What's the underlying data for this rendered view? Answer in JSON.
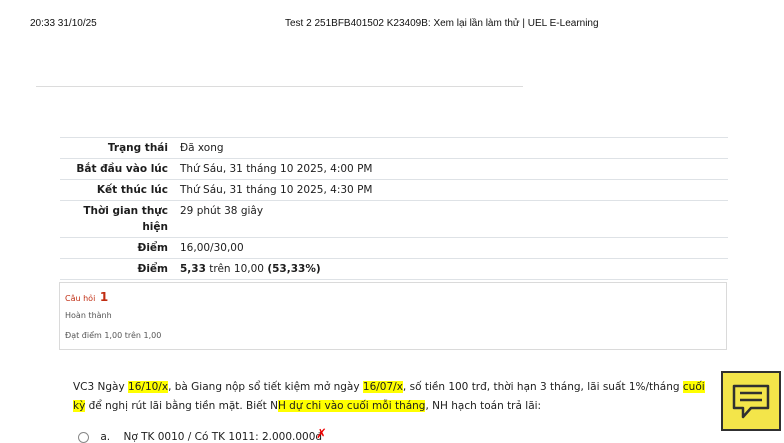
{
  "print_header": {
    "timestamp": "20:33 31/10/25",
    "title": "Test 2 251BFB401502 K23409B: Xem lại lần làm thử | UEL E-Learning"
  },
  "summary": {
    "rows": [
      {
        "label": "Trạng thái",
        "value": "Đã xong"
      },
      {
        "label": "Bắt đầu vào lúc",
        "value": "Thứ Sáu, 31 tháng 10 2025, 4:00 PM"
      },
      {
        "label": "Kết thúc lúc",
        "value": "Thứ Sáu, 31 tháng 10 2025, 4:30 PM"
      },
      {
        "label": "Thời gian thực hiện",
        "value": "29 phút 38 giây"
      },
      {
        "label": "Điểm",
        "value": "16,00/30,00"
      }
    ],
    "grade_row": {
      "label": "Điểm",
      "score": "5,33",
      "middle": " trên 10,00 ",
      "percent": "(53,33%)"
    }
  },
  "question": {
    "number_prefix": "Câu hỏi",
    "number": "1",
    "state": "Hoàn thành",
    "grade": "Đạt điểm 1,00 trên 1,00",
    "text_parts": [
      {
        "t": "VC3 Ngày ",
        "hl": false
      },
      {
        "t": "16/10/x",
        "hl": true
      },
      {
        "t": ", bà Giang nộp sổ tiết kiệm mở ngày ",
        "hl": false
      },
      {
        "t": "16/07/x",
        "hl": true
      },
      {
        "t": ", số tiền 100 trđ, thời hạn 3 tháng, lãi suất 1%/tháng ",
        "hl": false
      },
      {
        "t": "cuối kỳ",
        "hl": true
      },
      {
        "t": " để nghị rút lãi bằng tiền mặt. Biết N",
        "hl": false
      },
      {
        "t": "H dự chi vào cuối mỗi tháng",
        "hl": true
      },
      {
        "t": ", NH hạch toán trả lãi:",
        "hl": false
      }
    ],
    "option_a": {
      "letter": "a.",
      "text": "Nợ TK 0010 / Có TK 1011: 2.000.000đ"
    }
  },
  "colors": {
    "highlight": "#ffff00",
    "question_number": "#c02d12",
    "chat_button": "#f3e54a"
  },
  "chat_button": {
    "icon": "chat-icon"
  }
}
